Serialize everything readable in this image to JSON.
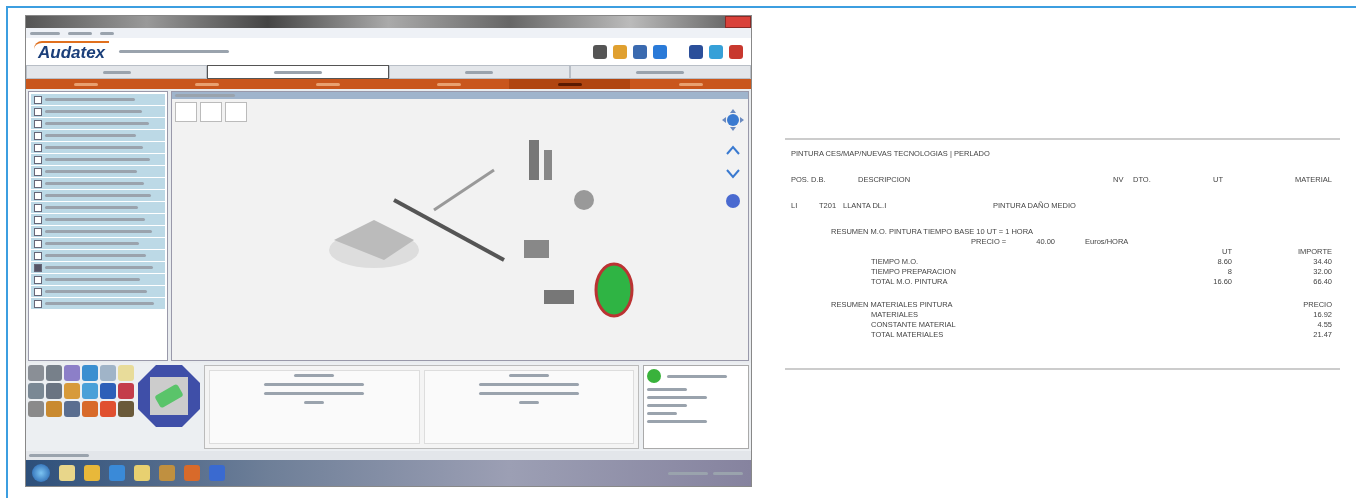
{
  "app_window": {
    "logo": "Audatex",
    "tabs": [
      {
        "selected": false
      },
      {
        "selected": true
      },
      {
        "selected": false
      },
      {
        "selected": false
      }
    ],
    "nav_items": [
      {
        "selected": false
      },
      {
        "selected": false
      },
      {
        "selected": false
      },
      {
        "selected": false
      },
      {
        "selected": true
      },
      {
        "selected": false
      }
    ],
    "part_list": [
      {
        "checked": false
      },
      {
        "checked": false
      },
      {
        "checked": false
      },
      {
        "checked": false
      },
      {
        "checked": false
      },
      {
        "checked": false
      },
      {
        "checked": false
      },
      {
        "checked": false
      },
      {
        "checked": false
      },
      {
        "checked": false
      },
      {
        "checked": false
      },
      {
        "checked": false
      },
      {
        "checked": false
      },
      {
        "checked": false
      },
      {
        "checked": true
      },
      {
        "checked": false
      },
      {
        "checked": false
      },
      {
        "checked": false
      }
    ]
  },
  "report": {
    "title": "PINTURA CES/MAP/NUEVAS TECNOLOGIAS | PERLADO",
    "columns": [
      "POS. D.B.",
      "DESCRIPCION",
      "NV",
      "DTO.",
      "UT",
      "MATERIAL"
    ],
    "item": {
      "pos": "LI",
      "code": "T201",
      "description": "LLANTA DL.I",
      "operation": "PINTURA DAÑO MEDIO"
    },
    "labor": {
      "heading": "RESUMEN M.O. PINTURA TIEMPO BASE 10 UT = 1 HORA",
      "price_label": "PRECIO =",
      "price": "40.00",
      "price_unit": "Euros/HORA",
      "col_ut": "UT",
      "col_amount": "IMPORTE",
      "rows": [
        {
          "label": "TIEMPO M.O.",
          "ut": "8.60",
          "amount": "34.40"
        },
        {
          "label": "TIEMPO PREPARACION",
          "ut": "8",
          "amount": "32.00"
        },
        {
          "label": "TOTAL M.O. PINTURA",
          "ut": "16.60",
          "amount": "66.40"
        }
      ]
    },
    "materials": {
      "heading": "RESUMEN MATERIALES PINTURA",
      "col_price": "PRECIO",
      "rows": [
        {
          "label": "MATERIALES",
          "price": "16.92"
        },
        {
          "label": "CONSTANTE MATERIAL",
          "price": "4.55"
        },
        {
          "label": "TOTAL MATERIALES",
          "price": "21.47"
        }
      ]
    }
  }
}
